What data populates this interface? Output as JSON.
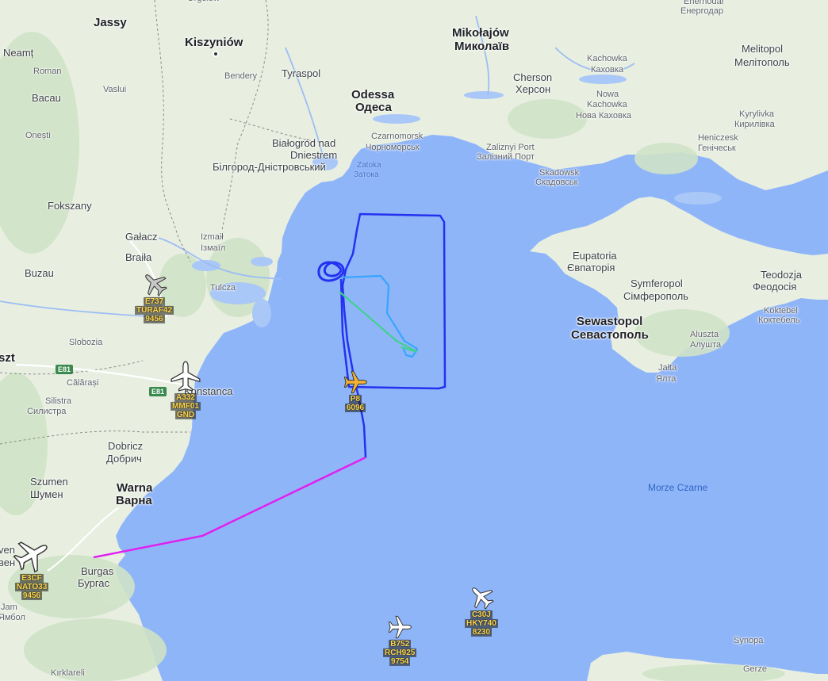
{
  "map": {
    "sea_label": "Morze Czarne",
    "places": [
      {
        "id": "jassy",
        "name": "Jassy",
        "cls": "big"
      },
      {
        "id": "kiszyniow",
        "name": "Kiszyniów",
        "cls": "big"
      },
      {
        "id": "neamt",
        "name": "Neamț",
        "cls": "mid"
      },
      {
        "id": "roman",
        "name": "Roman",
        "cls": "sm"
      },
      {
        "id": "bendery",
        "name": "Bendery",
        "cls": "sm"
      },
      {
        "id": "tyraspol",
        "name": "Tyraspol",
        "cls": "mid"
      },
      {
        "id": "bacau",
        "name": "Bacau",
        "cls": "mid"
      },
      {
        "id": "vaslui",
        "name": "Vaslui",
        "cls": "sm"
      },
      {
        "id": "onesti",
        "name": "Onești",
        "cls": "sm"
      },
      {
        "id": "odessa",
        "name": "Odessa",
        "cls": "big"
      },
      {
        "id": "odessa_uk",
        "name": "Одеса",
        "cls": "big"
      },
      {
        "id": "mikolajow",
        "name": "Mikołajów",
        "cls": "big"
      },
      {
        "id": "mikolajow_uk",
        "name": "Миколаїв",
        "cls": "big"
      },
      {
        "id": "cherson",
        "name": "Cherson",
        "cls": "mid"
      },
      {
        "id": "cherson_uk",
        "name": "Херсон",
        "cls": "mid"
      },
      {
        "id": "kachowka",
        "name": "Kachowka",
        "cls": "sm"
      },
      {
        "id": "kachowka_uk",
        "name": "Каховка",
        "cls": "sm"
      },
      {
        "id": "nowa_kach",
        "name": "Nowa",
        "cls": "sm"
      },
      {
        "id": "nowa_kach2",
        "name": "Kachowka",
        "cls": "sm"
      },
      {
        "id": "nowa_kach_uk",
        "name": "Нова Каховка",
        "cls": "sm"
      },
      {
        "id": "enerhodar",
        "name": "Enerhodar",
        "cls": "sm"
      },
      {
        "id": "enerhodar_uk",
        "name": "Енергодар",
        "cls": "sm"
      },
      {
        "id": "melitopol",
        "name": "Melitopol",
        "cls": "mid"
      },
      {
        "id": "melitopol_uk",
        "name": "Мелітополь",
        "cls": "mid"
      },
      {
        "id": "kyrylivka",
        "name": "Kyrylivka",
        "cls": "sm"
      },
      {
        "id": "kyrylivka_uk",
        "name": "Кирилівка",
        "cls": "sm"
      },
      {
        "id": "heniczesk",
        "name": "Heniczesk",
        "cls": "sm"
      },
      {
        "id": "heniczesk_uk",
        "name": "Генічеськ",
        "cls": "sm"
      },
      {
        "id": "czarnomorsk",
        "name": "Czarnomorsk",
        "cls": "sm"
      },
      {
        "id": "czarnomorsk_uk",
        "name": "Чорноморськ",
        "cls": "sm"
      },
      {
        "id": "zaliznyi",
        "name": "Zaliznyi Port",
        "cls": "sm"
      },
      {
        "id": "zaliznyi_uk",
        "name": "Залізний Порт",
        "cls": "sm"
      },
      {
        "id": "skadowsk",
        "name": "Skadowsk",
        "cls": "sm"
      },
      {
        "id": "skadowsk_uk",
        "name": "Скадовськ",
        "cls": "sm"
      },
      {
        "id": "bialogrod",
        "name": "Białogród nad",
        "cls": "mid"
      },
      {
        "id": "bialogrod2",
        "name": "Dniestrem",
        "cls": "mid"
      },
      {
        "id": "bilhorod_uk",
        "name": "Білгород-Дністровський",
        "cls": "mid"
      },
      {
        "id": "zatoka",
        "name": "Zatoka",
        "cls": "wl"
      },
      {
        "id": "zatoka_uk",
        "name": "Затока",
        "cls": "wl"
      },
      {
        "id": "focsani",
        "name": "Fokszany",
        "cls": "mid"
      },
      {
        "id": "galacz",
        "name": "Gałacz",
        "cls": "mid"
      },
      {
        "id": "braila",
        "name": "Braiła",
        "cls": "mid"
      },
      {
        "id": "izmail",
        "name": "Izmaił",
        "cls": "sm"
      },
      {
        "id": "izmail_uk",
        "name": "Ізмаїл",
        "cls": "sm"
      },
      {
        "id": "buzau",
        "name": "Buzau",
        "cls": "mid"
      },
      {
        "id": "tulcza",
        "name": "Tulcza",
        "cls": "sm"
      },
      {
        "id": "slobozia",
        "name": "Slobozia",
        "cls": "sm"
      },
      {
        "id": "szt",
        "name": "szt",
        "cls": "big"
      },
      {
        "id": "calarasi",
        "name": "Călărași",
        "cls": "sm"
      },
      {
        "id": "konstanca",
        "name": "Konstanca",
        "cls": "mid"
      },
      {
        "id": "silistra",
        "name": "Silistra",
        "cls": "sm"
      },
      {
        "id": "silistra_bg",
        "name": "Силистра",
        "cls": "sm"
      },
      {
        "id": "dobricz",
        "name": "Dobricz",
        "cls": "mid"
      },
      {
        "id": "dobricz_bg",
        "name": "Добрич",
        "cls": "mid"
      },
      {
        "id": "szumen",
        "name": "Szumen",
        "cls": "mid"
      },
      {
        "id": "szumen_bg",
        "name": "Шумен",
        "cls": "mid"
      },
      {
        "id": "warna",
        "name": "Warna",
        "cls": "big"
      },
      {
        "id": "warna_bg",
        "name": "Варна",
        "cls": "big"
      },
      {
        "id": "burgas",
        "name": "Burgas",
        "cls": "mid"
      },
      {
        "id": "burgas_bg",
        "name": "Бургас",
        "cls": "mid"
      },
      {
        "id": "jambol",
        "name": "Jam",
        "cls": "sm"
      },
      {
        "id": "jambol_bg",
        "name": "Ямбол",
        "cls": "sm"
      },
      {
        "id": "kirklareli",
        "name": "Kırklareli",
        "cls": "sm"
      },
      {
        "id": "eupatoria",
        "name": "Eupatoria",
        "cls": "mid"
      },
      {
        "id": "eupatoria_uk",
        "name": "Євпаторія",
        "cls": "mid"
      },
      {
        "id": "symferopol",
        "name": "Symferopol",
        "cls": "mid"
      },
      {
        "id": "symferopol_uk",
        "name": "Сімферополь",
        "cls": "mid"
      },
      {
        "id": "teodozja",
        "name": "Teodozja",
        "cls": "mid"
      },
      {
        "id": "teodozja_uk",
        "name": "Феодосія",
        "cls": "mid"
      },
      {
        "id": "koktebel",
        "name": "Koktebel",
        "cls": "sm"
      },
      {
        "id": "koktebel_uk",
        "name": "Коктебель",
        "cls": "sm"
      },
      {
        "id": "sewastopol",
        "name": "Sewastopol",
        "cls": "big"
      },
      {
        "id": "sewastopol_uk",
        "name": "Севастополь",
        "cls": "big"
      },
      {
        "id": "aluszta",
        "name": "Aluszta",
        "cls": "sm"
      },
      {
        "id": "aluszta_uk",
        "name": "Алушта",
        "cls": "sm"
      },
      {
        "id": "jalta",
        "name": "Jałta",
        "cls": "sm"
      },
      {
        "id": "jalta_uk",
        "name": "Ялта",
        "cls": "sm"
      },
      {
        "id": "synopa",
        "name": "Synopa",
        "cls": "sm"
      },
      {
        "id": "gerze",
        "name": "Gerze",
        "cls": "sm"
      },
      {
        "id": "orgeyev",
        "name": "Orgeiów",
        "cls": "sm"
      },
      {
        "id": "ven",
        "name": "ven",
        "cls": "mid"
      },
      {
        "id": "ven2",
        "name": "вен",
        "cls": "mid"
      }
    ],
    "roads": [
      "E81",
      "E81"
    ]
  },
  "aircraft": [
    {
      "id": "e737",
      "lines": [
        "E737",
        "TURAF42",
        "9456"
      ],
      "color": "#c8c8c8"
    },
    {
      "id": "a332",
      "lines": [
        "A332",
        "MMF01",
        "GND"
      ],
      "color": "#ffffff"
    },
    {
      "id": "p8",
      "lines": [
        "P8",
        "6096"
      ],
      "color": "#f2b233"
    },
    {
      "id": "e3cf",
      "lines": [
        "E3CF",
        "NATO33",
        "9456"
      ],
      "color": "#ffffff"
    },
    {
      "id": "b752",
      "lines": [
        "B752",
        "RCH925",
        "9754"
      ],
      "color": "#ffffff"
    },
    {
      "id": "c30j",
      "lines": [
        "C30J",
        "HKY740",
        "8230"
      ],
      "color": "#ffffff"
    }
  ],
  "colors": {
    "sea": "#8fb5f9",
    "land": "#e9efe3",
    "track_blue": "#2432f0",
    "track_magenta": "#e020f0",
    "track_cyan": "#38a5ff",
    "track_green": "#40d090"
  }
}
